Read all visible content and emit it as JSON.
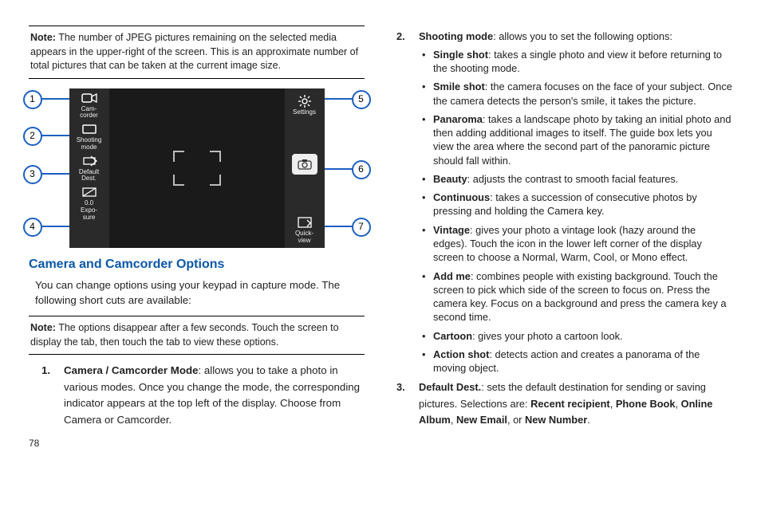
{
  "left_column": {
    "note1_label": "Note:",
    "note1_text": " The number of JPEG pictures remaining on the selected media appears in the upper-right of the screen. This is an approximate number of total pictures that can be taken at the current image size.",
    "heading": "Camera and Camcorder Options",
    "intro": "You can change options using your keypad in capture mode. The following short cuts are available:",
    "note2_label": "Note:",
    "note2_text": " The options disappear after a few seconds. Touch the screen to display the tab, then touch the tab to view these options.",
    "item1_num": "1.",
    "item1_bold": "Camera / Camcorder Mode",
    "item1_rest": ": allows you to take a photo in various modes. Once you change the mode, the corresponding indicator appears at the top left of the display. Choose from Camera or Camcorder.",
    "page_number": "78"
  },
  "figure": {
    "callouts": {
      "c1": "1",
      "c2": "2",
      "c3": "3",
      "c4": "4",
      "c5": "5",
      "c6": "6",
      "c7": "7"
    },
    "labels": {
      "camcorder": "Cam-\ncorder",
      "shooting": "Shooting\nmode",
      "default": "Default\nDest.",
      "exposure": "0.0\nExpo-\nsure",
      "settings": "Settings",
      "quickview": "Quick-\nview"
    }
  },
  "right_column": {
    "item2_num": "2.",
    "item2_bold": "Shooting mode",
    "item2_rest": ": allows you to set the following options:",
    "bullets": {
      "single_b": "Single shot",
      "single_r": ": takes a single photo and view it before returning to the shooting mode.",
      "smile_b": "Smile shot",
      "smile_r": ": the camera focuses on the face of your subject. Once the camera detects the person's smile, it takes the picture.",
      "pano_b": "Panaroma",
      "pano_r": ": takes a landscape photo by taking an initial photo and then adding additional images to itself. The guide box lets you view the area where the second part of the panoramic picture should fall within.",
      "beauty_b": "Beauty",
      "beauty_r": ": adjusts the contrast to smooth facial features.",
      "cont_b": "Continuous",
      "cont_r": ": takes a succession of consecutive photos by pressing and holding the Camera key.",
      "vint_b": "Vintage",
      "vint_r": ": gives your photo a vintage look (hazy around the edges). Touch the icon in the lower left corner of the display screen to choose a Normal, Warm, Cool, or Mono effect.",
      "add_b": "Add me",
      "add_r": ": combines people with existing background. Touch the screen to pick which side of the screen to focus on. Press the camera key. Focus on a background and press the camera key a second time.",
      "cart_b": "Cartoon",
      "cart_r": ": gives your photo a cartoon look.",
      "act_b": "Action shot",
      "act_r": ": detects action and creates a panorama of the moving object."
    },
    "item3_num": "3.",
    "item3_bold": "Default Dest.",
    "item3_text1": ": sets the default destination for sending or saving pictures. Selections are: ",
    "sel1": "Recent recipient",
    "sep1": ", ",
    "sel2": "Phone Book",
    "sep2": ", ",
    "sel3": "Online Album",
    "sep3": ", ",
    "sel4": "New Email",
    "sep4": ", or ",
    "sel5": "New Number",
    "end": "."
  }
}
